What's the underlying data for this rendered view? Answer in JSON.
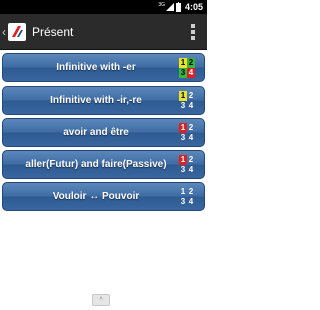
{
  "status_bar": {
    "network": "3G",
    "time": "4:05"
  },
  "action_bar": {
    "back_glyph": "‹",
    "title": "Présent",
    "overflow_icon": "overflow-menu-icon"
  },
  "menu": [
    {
      "label": "Infinitive with -er",
      "cells": [
        "1",
        "2",
        "3",
        "4"
      ]
    },
    {
      "label": "Infinitive with -ir,-re",
      "cells": [
        "1",
        "2",
        "3",
        "4"
      ]
    },
    {
      "label": "avoir and être",
      "cells": [
        "1",
        "2",
        "3",
        "4"
      ]
    },
    {
      "label": "aller(Futur) and faire(Passive)",
      "cells": [
        "1",
        "2",
        "3",
        "4"
      ]
    },
    {
      "label": "Vouloir ↔ Pouvoir",
      "cells": [
        "1",
        "2",
        "3",
        "4"
      ]
    }
  ],
  "colors": {
    "button_top": "#5b87bb",
    "button_bottom": "#2e5a92",
    "action_bar": "#2b2b2b",
    "cell_yellow": "#e9e32a",
    "cell_green": "#38b53c",
    "cell_red": "#e02020"
  },
  "bottom": {
    "handle_glyph": "^"
  }
}
